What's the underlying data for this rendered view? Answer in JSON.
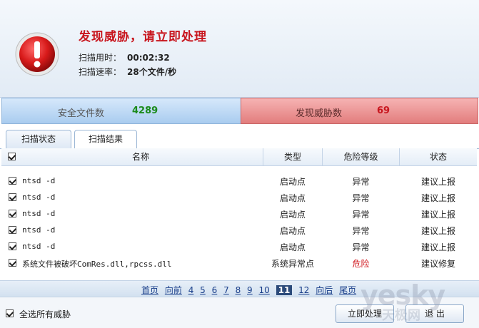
{
  "header": {
    "headline": "发现威胁，请立即处理",
    "scan_time_label": "扫描用时：",
    "scan_time_value": "00:02:32",
    "scan_speed_label": "扫描速率：",
    "scan_speed_value": "28个文件/秒"
  },
  "stats": {
    "safe_label": "安全文件数",
    "safe_value": "4289",
    "threat_label": "发现威胁数",
    "threat_value": "69"
  },
  "tabs": [
    {
      "label": "扫描状态"
    },
    {
      "label": "扫描结果"
    }
  ],
  "table": {
    "columns": [
      "名称",
      "类型",
      "危险等级",
      "状态"
    ],
    "rows": [
      {
        "name": "ntsd -d",
        "type": "启动点",
        "level": "异常",
        "status": "建议上报"
      },
      {
        "name": "ntsd -d",
        "type": "启动点",
        "level": "异常",
        "status": "建议上报"
      },
      {
        "name": "ntsd -d",
        "type": "启动点",
        "level": "异常",
        "status": "建议上报"
      },
      {
        "name": "ntsd -d",
        "type": "启动点",
        "level": "异常",
        "status": "建议上报"
      },
      {
        "name": "ntsd -d",
        "type": "启动点",
        "level": "异常",
        "status": "建议上报"
      },
      {
        "name": "系统文件被破坏ComRes.dll,rpcss.dll",
        "type": "系统异常点",
        "level": "危险",
        "status": "建议修复"
      }
    ]
  },
  "pager": {
    "items": [
      "首页",
      "向前",
      "4",
      "5",
      "6",
      "7",
      "8",
      "9",
      "10",
      "11",
      "12",
      "向后",
      "尾页"
    ],
    "current": "11"
  },
  "footer": {
    "select_all_label": "全选所有威胁",
    "handle_button": "立即处理",
    "exit_button": "退 出"
  },
  "watermark": {
    "brand": "yesky",
    "sub": "天极网"
  },
  "colors": {
    "headline": "#c8161e",
    "safe_value": "#1a8a1a",
    "threat_value": "#c8161e",
    "danger": "#d0141b"
  }
}
